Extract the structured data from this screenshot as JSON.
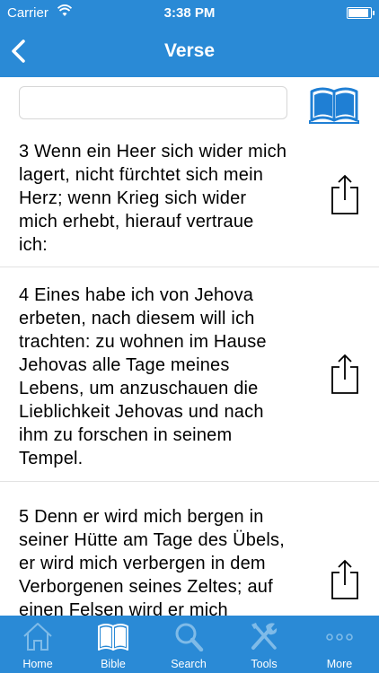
{
  "status": {
    "carrier": "Carrier",
    "time": "3:38 PM"
  },
  "nav": {
    "title": "Verse"
  },
  "search": {
    "value": "",
    "placeholder": ""
  },
  "verses": [
    {
      "text": "3 Wenn ein Heer sich wider mich\nlagert, nicht fürchtet sich mein\nHerz; wenn Krieg sich wider\nmich erhebt, hierauf vertraue\nich:"
    },
    {
      "text": "4 Eines habe ich von Jehova\nerbeten, nach diesem will ich\ntrachten: zu wohnen im Hause\nJehovas alle Tage meines\nLebens, um anzuschauen die\nLieblichkeit Jehovas und nach\nihm zu forschen in seinem\nTempel."
    },
    {
      "text": "5 Denn er wird mich bergen in\nseiner Hütte am Tage des Übels,\ner wird mich verbergen in dem\nVerborgenen seines Zeltes; auf\neinen Felsen wird er mich"
    }
  ],
  "tabs": [
    {
      "label": "Home",
      "icon": "home-icon"
    },
    {
      "label": "Bible",
      "icon": "book-icon"
    },
    {
      "label": "Search",
      "icon": "search-icon"
    },
    {
      "label": "Tools",
      "icon": "tools-icon"
    },
    {
      "label": "More",
      "icon": "more-icon"
    }
  ],
  "colors": {
    "primary": "#2a8ad6",
    "tab_inactive": "#7fbbe8",
    "tab_active": "#ffffff",
    "icon_blue": "#1f7fd4"
  }
}
